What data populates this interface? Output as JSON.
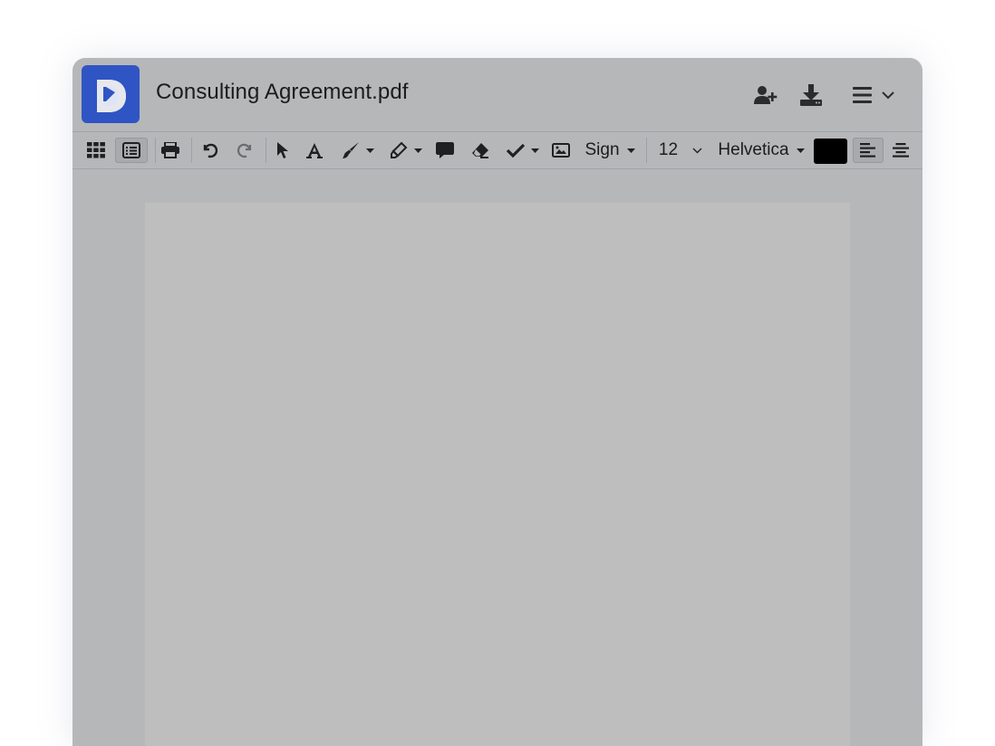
{
  "header": {
    "document_title": "Consulting Agreement.pdf"
  },
  "toolbar": {
    "sign_label": "Sign",
    "font_size": "12",
    "font_family": "Helvetica",
    "text_color": "#000000"
  },
  "colors": {
    "accent": "#2f55c4",
    "window_bg": "#b6b7b9",
    "page_bg": "#bebebe"
  },
  "icons": {
    "header": [
      "app-logo-icon",
      "add-user-icon",
      "download-icon",
      "menu-icon",
      "chevron-down-icon"
    ],
    "toolbar": [
      "grid-view-icon",
      "list-view-icon",
      "print-icon",
      "undo-icon",
      "redo-icon",
      "pointer-icon",
      "text-tool-icon",
      "pen-icon",
      "highlighter-icon",
      "comment-icon",
      "eraser-icon",
      "checkmark-icon",
      "image-icon",
      "align-left-icon",
      "align-center-icon"
    ]
  }
}
